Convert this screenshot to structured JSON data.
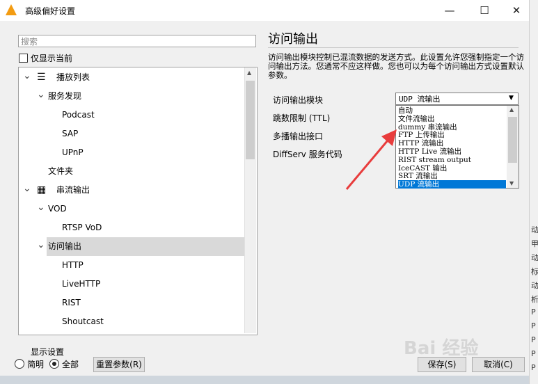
{
  "window": {
    "title": "高级偏好设置",
    "minimize": "—",
    "maximize": "☐",
    "close": "✕"
  },
  "sidebar": {
    "search_placeholder": "搜索",
    "show_current_label": "仅显示当前",
    "tree": [
      {
        "label": "播放列表",
        "level": 0,
        "expanded": true,
        "icon": "playlist-icon"
      },
      {
        "label": "服务发现",
        "level": 1,
        "expanded": true
      },
      {
        "label": "Podcast",
        "level": 2
      },
      {
        "label": "SAP",
        "level": 2
      },
      {
        "label": "UPnP",
        "level": 2
      },
      {
        "label": "文件夹",
        "level": 1
      },
      {
        "label": "串流输出",
        "level": 0,
        "expanded": true,
        "icon": "stream-output-icon"
      },
      {
        "label": "VOD",
        "level": 1,
        "expanded": true
      },
      {
        "label": "RTSP VoD",
        "level": 2
      },
      {
        "label": "访问输出",
        "level": 1,
        "expanded": true,
        "selected": true
      },
      {
        "label": "HTTP",
        "level": 2
      },
      {
        "label": "LiveHTTP",
        "level": 2
      },
      {
        "label": "RIST",
        "level": 2
      },
      {
        "label": "Shoutcast",
        "level": 2
      }
    ]
  },
  "main": {
    "title": "访问输出",
    "description": "访问输出模块控制已混流数据的发送方式。此设置允许您强制指定一个访问输出方法。您通常不应这样做。您也可以为每个访问输出方式设置默认参数。",
    "fields": {
      "module_label": "访问输出模块",
      "ttl_label": "跳数限制 (TTL)",
      "multicast_label": "多播输出接口",
      "diffserv_label": "DiffServ 服务代码"
    },
    "combo_value": "UDP 流输出",
    "dropdown_options": [
      "自动",
      "文件流输出",
      "dummy 串流输出",
      "FTP 上传输出",
      "HTTP 流输出",
      "HTTP Live 流输出",
      "RIST stream output",
      "IceCAST 输出",
      "SRT 流输出",
      "UDP 流输出"
    ],
    "dropdown_selected": "UDP 流输出"
  },
  "footer": {
    "display_settings_label": "显示设置",
    "simple_label": "简明",
    "all_label": "全部",
    "reset_label": "重置参数(R)",
    "save_label": "保存(S)",
    "cancel_label": "取消(C)"
  },
  "background_app_chars": [
    "动",
    "甲",
    "动",
    "标",
    "动",
    "析",
    "P",
    "P",
    "P",
    "P",
    "P"
  ],
  "watermark": "Bai 经验",
  "colors": {
    "selection": "#0078d7",
    "annotation_arrow": "#e83c3c",
    "vlc_cone": "#f39c12"
  }
}
